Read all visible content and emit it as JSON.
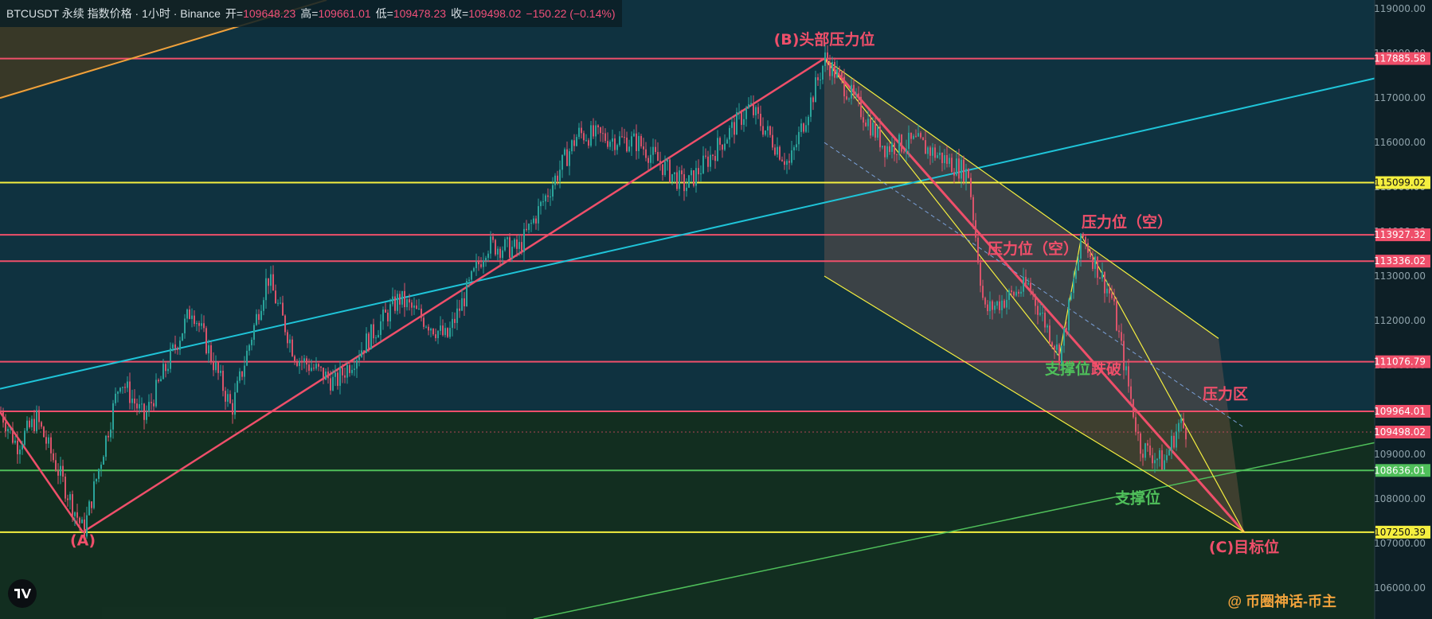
{
  "header": {
    "symbol_line": "BTCUSDT 永续 指数价格 · 1小时 · Binance",
    "open_label": "开=",
    "open": "109648.23",
    "high_label": "高=",
    "high": "109661.01",
    "low_label": "低=",
    "low": "109478.23",
    "close_label": "收=",
    "close": "109498.02",
    "change": "−150.22 (−0.14%)"
  },
  "watermark": "@ 币圈神话-币主",
  "colors": {
    "bg": "#0f2730",
    "red": "#ef4f6a",
    "yellow": "#f5ef3f",
    "green": "#4fbf5a",
    "cyan": "#1fc4d8",
    "orange": "#f0a23c",
    "candle_up": "#2aa39a",
    "candle_down": "#d9536a"
  },
  "chart_data": {
    "type": "candlestick",
    "y_axis": {
      "min": 105300,
      "max": 119200,
      "ticks": [
        106000,
        107000,
        108000,
        109000,
        110000,
        111000,
        112000,
        113000,
        114000,
        115000,
        116000,
        117000,
        118000,
        119000
      ]
    },
    "price_lines": [
      {
        "value": 117885.58,
        "label": "117885.58",
        "color": "red"
      },
      {
        "value": 115099.02,
        "label": "115099.02",
        "color": "yellow"
      },
      {
        "value": 113927.32,
        "label": "113927.32",
        "color": "red"
      },
      {
        "value": 113336.02,
        "label": "113336.02",
        "color": "red"
      },
      {
        "value": 111076.79,
        "label": "111076.79",
        "color": "red"
      },
      {
        "value": 109964.01,
        "label": "109964.01",
        "color": "red"
      },
      {
        "value": 109498.02,
        "label": "109498.02",
        "color": "red",
        "style": "dotted"
      },
      {
        "value": 108636.01,
        "label": "108636.01",
        "color": "green"
      },
      {
        "value": 107250.39,
        "label": "107250.39",
        "color": "yellow"
      }
    ],
    "annotations": [
      {
        "text": "(A)",
        "color": "red",
        "bar": 104,
        "price": 106950
      },
      {
        "text": "(B)头部压力位",
        "color": "red",
        "bar": 1035,
        "price": 118200
      },
      {
        "text": "(C)目标位",
        "color": "red",
        "bar": 1562,
        "price": 106800
      },
      {
        "text": "压力位（空）",
        "color": "red",
        "bar": 1358,
        "price": 114100
      },
      {
        "text": "压力位（空）",
        "color": "red",
        "bar": 1240,
        "price": 113500
      },
      {
        "text": "支撑位",
        "color": "green",
        "bar": 1312,
        "price": 110800
      },
      {
        "text": "跌破",
        "color": "red",
        "bar": 1370,
        "price": 110800
      },
      {
        "text": "压力区",
        "color": "red",
        "bar": 1510,
        "price": 110240
      },
      {
        "text": "支撑位",
        "color": "green",
        "bar": 1400,
        "price": 107900
      }
    ],
    "waypoints": [
      [
        0,
        109950
      ],
      [
        20,
        109200
      ],
      [
        45,
        109800
      ],
      [
        104,
        107250
      ],
      [
        150,
        110700
      ],
      [
        180,
        109800
      ],
      [
        240,
        112300
      ],
      [
        290,
        110000
      ],
      [
        335,
        113000
      ],
      [
        370,
        111200
      ],
      [
        420,
        110600
      ],
      [
        500,
        112500
      ],
      [
        560,
        111600
      ],
      [
        610,
        113700
      ],
      [
        650,
        113600
      ],
      [
        725,
        116200
      ],
      [
        800,
        116000
      ],
      [
        860,
        115000
      ],
      [
        940,
        116800
      ],
      [
        990,
        115500
      ],
      [
        1035,
        117885
      ],
      [
        1070,
        117000
      ],
      [
        1110,
        115900
      ],
      [
        1150,
        116000
      ],
      [
        1215,
        115300
      ],
      [
        1235,
        112200
      ],
      [
        1290,
        112800
      ],
      [
        1330,
        111200
      ],
      [
        1358,
        113900
      ],
      [
        1395,
        112500
      ],
      [
        1415,
        110600
      ],
      [
        1430,
        109200
      ],
      [
        1460,
        108800
      ],
      [
        1480,
        109700
      ],
      [
        1490,
        109498
      ]
    ]
  }
}
